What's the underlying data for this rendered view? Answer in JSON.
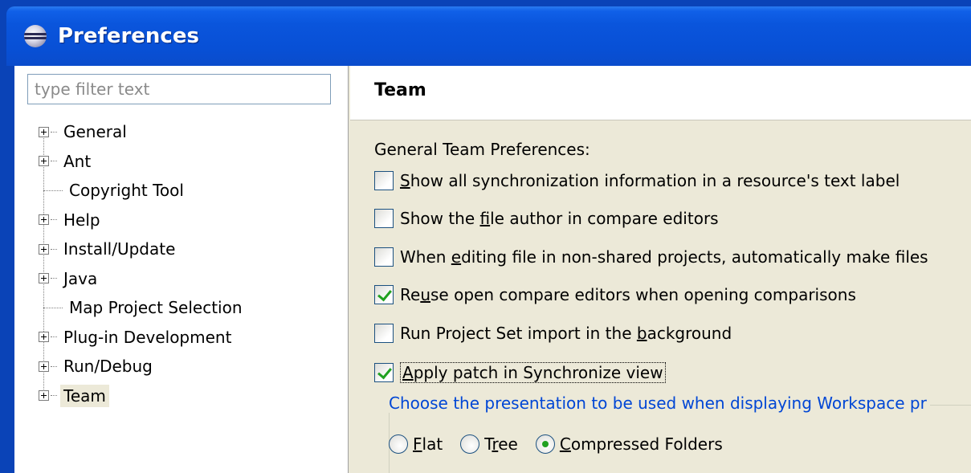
{
  "window": {
    "title": "Preferences"
  },
  "filter": {
    "placeholder": "type filter text",
    "value": ""
  },
  "tree": {
    "items": [
      {
        "label": "General",
        "expandable": true,
        "selected": false
      },
      {
        "label": "Ant",
        "expandable": true,
        "selected": false
      },
      {
        "label": "Copyright Tool",
        "expandable": false,
        "selected": false
      },
      {
        "label": "Help",
        "expandable": true,
        "selected": false
      },
      {
        "label": "Install/Update",
        "expandable": true,
        "selected": false
      },
      {
        "label": "Java",
        "expandable": true,
        "selected": false
      },
      {
        "label": "Map Project Selection",
        "expandable": false,
        "selected": false
      },
      {
        "label": "Plug-in Development",
        "expandable": true,
        "selected": false
      },
      {
        "label": "Run/Debug",
        "expandable": true,
        "selected": false
      },
      {
        "label": "Team",
        "expandable": true,
        "selected": true
      }
    ]
  },
  "page": {
    "title": "Team",
    "section_label": "General Team Preferences:",
    "options": [
      {
        "pre": "",
        "mnemonic": "S",
        "post": "how all synchronization information in a resource's text label",
        "checked": false
      },
      {
        "pre": "Show the ",
        "mnemonic": "f",
        "post": "ile author in compare editors",
        "checked": false
      },
      {
        "pre": "When ",
        "mnemonic": "e",
        "post": "diting file in non-shared projects, automatically make files",
        "checked": false
      },
      {
        "pre": "Re",
        "mnemonic": "u",
        "post": "se open compare editors when opening comparisons",
        "checked": true
      },
      {
        "pre": "Run Project Set import in the ",
        "mnemonic": "b",
        "post": "ackground",
        "checked": false
      },
      {
        "pre": "",
        "mnemonic": "A",
        "post": "pply patch in Synchronize view",
        "checked": true
      }
    ],
    "presentation": {
      "legend": "Choose the presentation to be used when displaying Workspace pr",
      "choices": [
        {
          "mnemonic": "F",
          "post": "lat",
          "pre": "",
          "checked": false
        },
        {
          "pre": "T",
          "mnemonic": "r",
          "post": "ee",
          "checked": false
        },
        {
          "pre": "",
          "mnemonic": "C",
          "post": "ompressed Folders",
          "checked": true
        }
      ]
    }
  }
}
